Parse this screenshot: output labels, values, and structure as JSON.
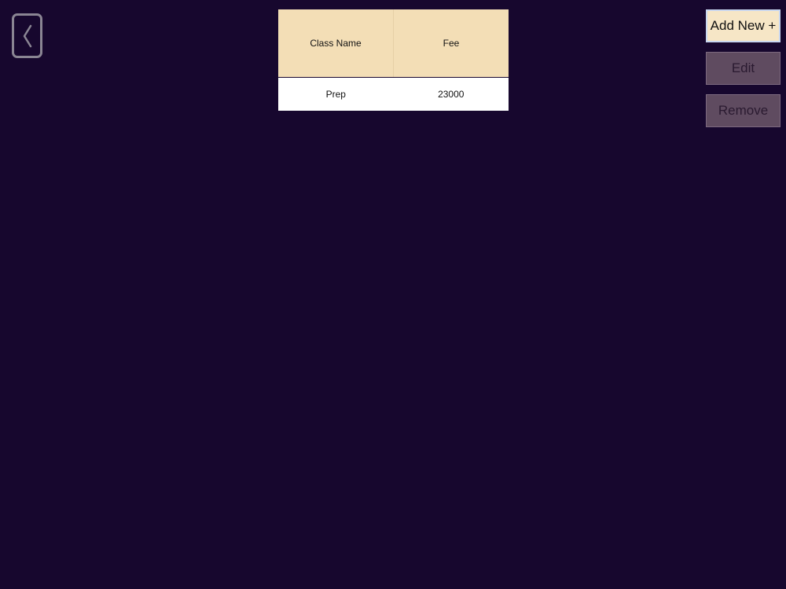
{
  "navigation": {
    "back_icon": "chevron-left-icon"
  },
  "table": {
    "columns": [
      "Class Name",
      "Fee"
    ],
    "rows": [
      [
        "Prep",
        "23000"
      ]
    ]
  },
  "actions": {
    "add_label": "Add New +",
    "edit_label": "Edit",
    "remove_label": "Remove"
  },
  "colors": {
    "background": "#17072e",
    "table_header": "#f3deb6",
    "table_row": "#ffffff",
    "primary_button": "#f6e6c6",
    "disabled_button": "#5f4b60"
  }
}
